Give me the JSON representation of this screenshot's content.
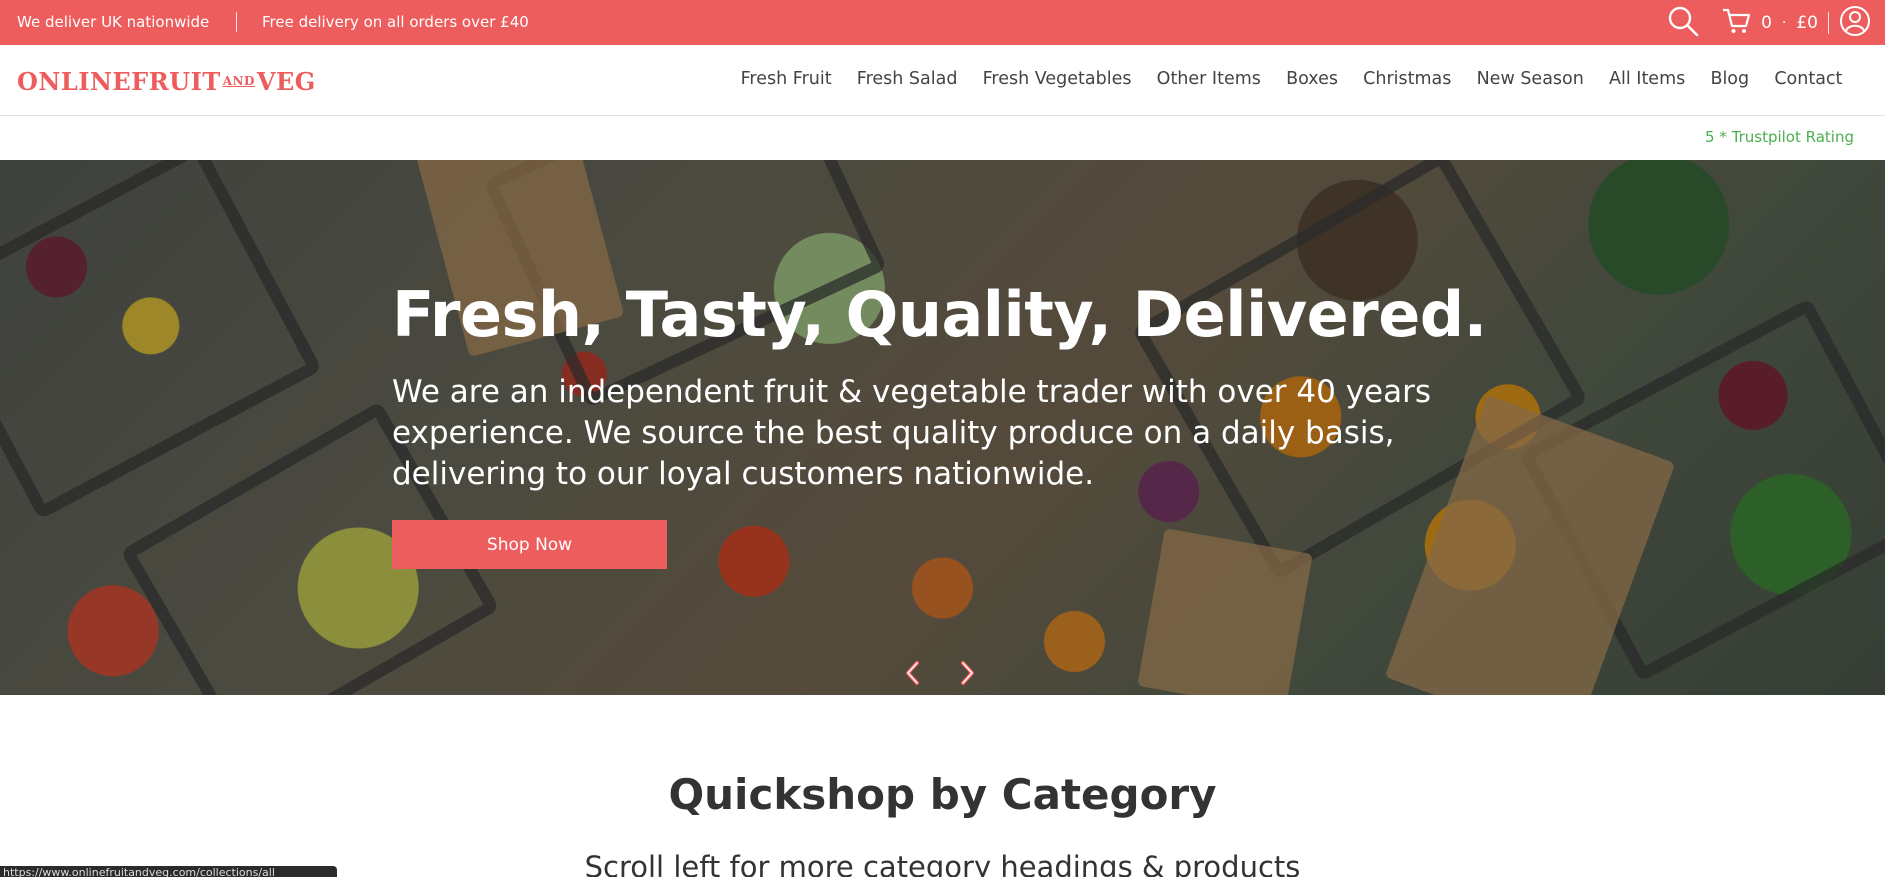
{
  "announcement": {
    "message_1": "We deliver UK nationwide",
    "message_2": "Free delivery on all orders over £40"
  },
  "top_tools": {
    "search_icon": "search-icon",
    "cart_icon": "cart-icon",
    "cart_count": "0",
    "cart_separator": "·",
    "cart_total": "£0",
    "account_icon": "user-icon"
  },
  "header": {
    "logo_part1": "ONLINEFRUIT",
    "logo_and": "AND",
    "logo_part2": "VEG",
    "nav": [
      "Fresh Fruit",
      "Fresh Salad",
      "Fresh Vegetables",
      "Other Items",
      "Boxes",
      "Christmas",
      "New Season",
      "All Items",
      "Blog",
      "Contact"
    ]
  },
  "trust": {
    "text": "5 * Trustpilot Rating"
  },
  "hero": {
    "title": "Fresh, Tasty, Quality, Delivered.",
    "text": "We are an independent fruit & vegetable trader with over 40 years experience. We source the best quality produce on a daily basis, delivering to our loyal customers nationwide.",
    "button": "Shop Now",
    "prev_icon": "chevron-left-icon",
    "next_icon": "chevron-right-icon"
  },
  "quickshop": {
    "title": "Quickshop by Category",
    "subtitle": "Scroll left for more category headings & products"
  },
  "status_bar": {
    "url": "https://www.onlinefruitandveg.com/collections/all"
  },
  "colors": {
    "brand": "#ee5d5d",
    "trust_green": "#4caf50",
    "text_dark": "#333333"
  }
}
